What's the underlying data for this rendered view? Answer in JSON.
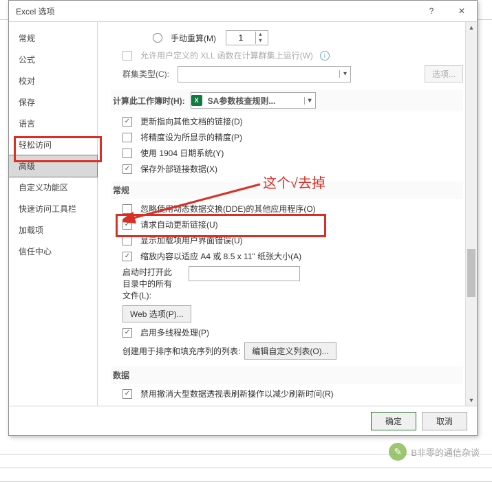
{
  "dialog": {
    "title": "Excel 选项",
    "help_symbol": "?",
    "close_symbol": "✕"
  },
  "sidebar": {
    "items": [
      {
        "label": "常规"
      },
      {
        "label": "公式"
      },
      {
        "label": "校对"
      },
      {
        "label": "保存"
      },
      {
        "label": "语言"
      },
      {
        "label": "轻松访问"
      },
      {
        "label": "高级",
        "selected": true
      },
      {
        "label": "自定义功能区"
      },
      {
        "label": "快速访问工具栏"
      },
      {
        "label": "加载项"
      },
      {
        "label": "信任中心"
      }
    ]
  },
  "content": {
    "manual_recalc": "手动重算(M)",
    "spinner_value": "1",
    "allow_xll": "允许用户定义的 XLL 函数在计算群集上运行(W)",
    "cluster_type_label": "群集类型(C):",
    "cluster_options_btn": "选项...",
    "calc_workbook_header": "计算此工作簿时(H):",
    "workbook_name": "SA参数核查规则...",
    "opts": {
      "update_links": "更新指向其他文档的链接(D)",
      "precision": "将精度设为所显示的精度(P)",
      "date1904": "使用 1904 日期系统(Y)",
      "save_ext": "保存外部链接数据(X)"
    },
    "section_general": "常规",
    "general": {
      "ignore_dde": "忽略使用动态数据交换(DDE)的其他应用程序(O)",
      "auto_update": "请求自动更新链接(U)",
      "addin_errors": "显示加载项用户界面错误(U)",
      "scale_fit": "缩放内容以适应 A4 或 8.5 x 11\" 纸张大小(A)",
      "startup_label": "启动时打开此\n目录中的所有\n文件(L):",
      "web_options_btn": "Web 选项(P)...",
      "multithread": "启用多线程处理(P)",
      "custom_list_label": "创建用于排序和填充序列的列表:",
      "custom_list_btn": "编辑自定义列表(O)..."
    },
    "section_data": "数据",
    "data": {
      "disable_undo": "禁用撤消大型数据透视表刷新操作以减少刷新时间(R)"
    }
  },
  "footer": {
    "ok": "确定",
    "cancel": "取消"
  },
  "annotation": {
    "text": "这个√去掉"
  },
  "watermark": {
    "text": "B非零的通信杂谈"
  }
}
